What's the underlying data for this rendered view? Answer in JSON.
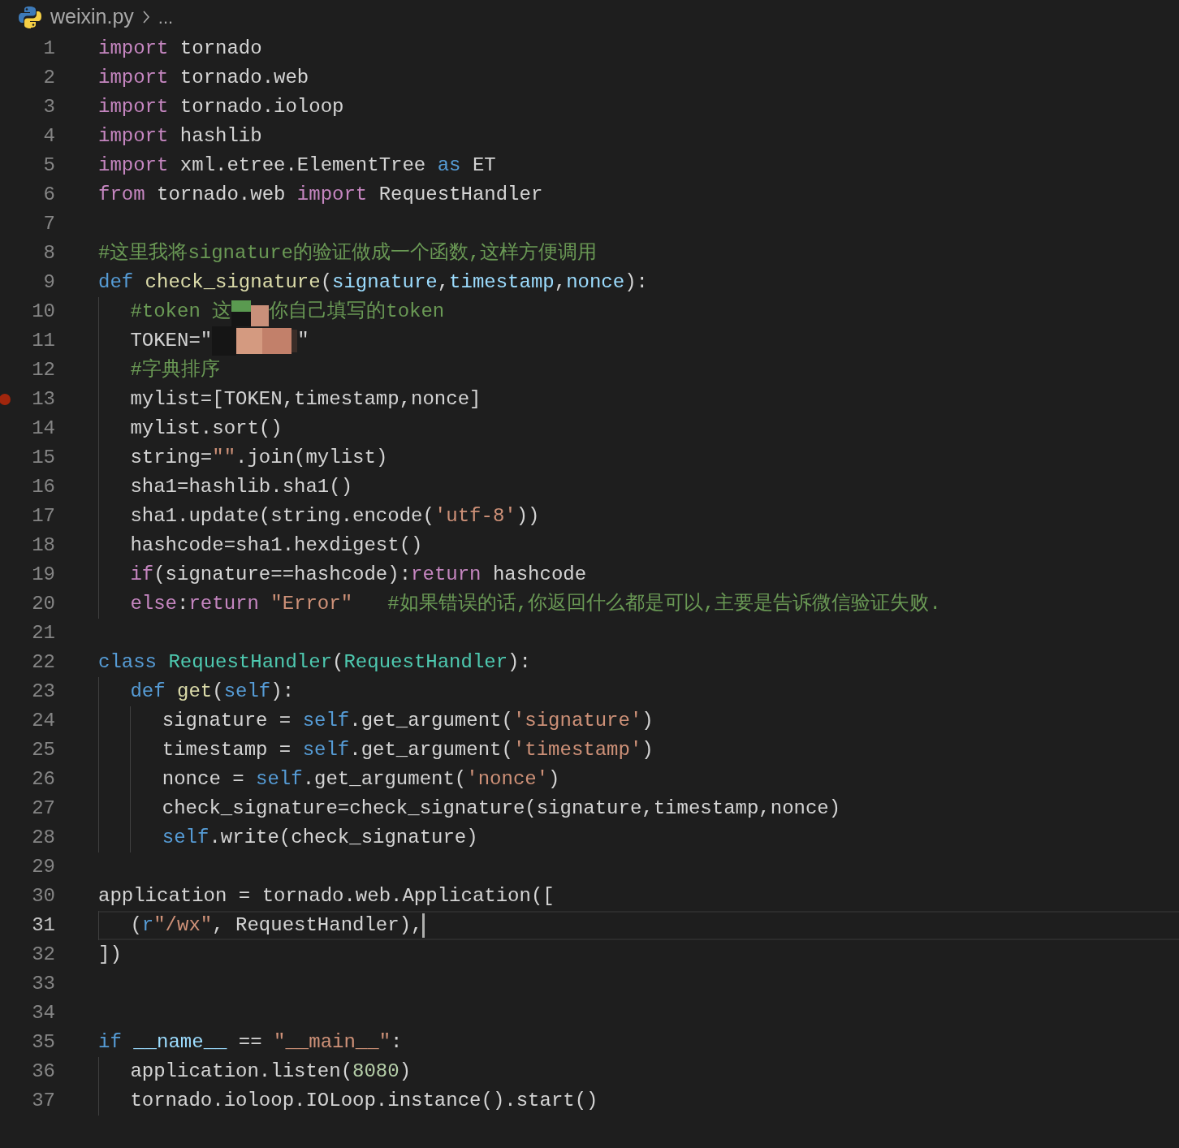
{
  "breadcrumb": {
    "file": "weixin.py",
    "more": "..."
  },
  "lines": [
    {
      "number": "1",
      "breakpoint": false,
      "current": false,
      "tokens": [
        {
          "kind": "kw",
          "text": "import"
        },
        {
          "kind": "tx",
          "text": " tornado"
        }
      ]
    },
    {
      "number": "2",
      "breakpoint": false,
      "current": false,
      "tokens": [
        {
          "kind": "kw",
          "text": "import"
        },
        {
          "kind": "tx",
          "text": " tornado.web"
        }
      ]
    },
    {
      "number": "3",
      "breakpoint": false,
      "current": false,
      "tokens": [
        {
          "kind": "kw",
          "text": "import"
        },
        {
          "kind": "tx",
          "text": " tornado.ioloop"
        }
      ]
    },
    {
      "number": "4",
      "breakpoint": false,
      "current": false,
      "tokens": [
        {
          "kind": "kw",
          "text": "import"
        },
        {
          "kind": "tx",
          "text": " hashlib"
        }
      ]
    },
    {
      "number": "5",
      "breakpoint": false,
      "current": false,
      "tokens": [
        {
          "kind": "kw",
          "text": "import"
        },
        {
          "kind": "tx",
          "text": " xml.etree.ElementTree "
        },
        {
          "kind": "st",
          "text": "as"
        },
        {
          "kind": "tx",
          "text": " ET"
        }
      ]
    },
    {
      "number": "6",
      "breakpoint": false,
      "current": false,
      "tokens": [
        {
          "kind": "kw",
          "text": "from"
        },
        {
          "kind": "tx",
          "text": " tornado.web "
        },
        {
          "kind": "kw",
          "text": "import"
        },
        {
          "kind": "tx",
          "text": " RequestHandler"
        }
      ]
    },
    {
      "number": "7",
      "breakpoint": false,
      "current": false
    },
    {
      "number": "8",
      "breakpoint": false,
      "current": false,
      "tokens": [
        {
          "kind": "cm",
          "text": "#这里我将signature的验证做成一个函数,这样方便调用"
        }
      ]
    },
    {
      "number": "9",
      "breakpoint": false,
      "current": false,
      "tokens": [
        {
          "kind": "st",
          "text": "def"
        },
        {
          "kind": "fn",
          "text": " check_signature"
        },
        {
          "kind": "tx",
          "text": "("
        },
        {
          "kind": "pa",
          "text": "signature"
        },
        {
          "kind": "tx",
          "text": ","
        },
        {
          "kind": "pa",
          "text": "timestamp"
        },
        {
          "kind": "tx",
          "text": ","
        },
        {
          "kind": "pa",
          "text": "nonce"
        },
        {
          "kind": "tx",
          "text": "):"
        }
      ]
    },
    {
      "number": "10",
      "breakpoint": false,
      "current": false,
      "tokens": [
        {
          "kind": "cm",
          "text": "    #token 这"
        },
        {
          "kind": "redaction"
        },
        {
          "kind": "cm",
          "text": "你自己填写的token"
        }
      ]
    },
    {
      "number": "11",
      "breakpoint": false,
      "current": false,
      "tokens": [
        {
          "kind": "tx",
          "text": "    TOKEN=\""
        },
        {
          "kind": "redaction"
        },
        {
          "kind": "tx",
          "text": "\""
        }
      ]
    },
    {
      "number": "12",
      "breakpoint": false,
      "current": false,
      "tokens": [
        {
          "kind": "cm",
          "text": "    #字典排序"
        }
      ]
    },
    {
      "number": "13",
      "breakpoint": true,
      "current": false,
      "tokens": [
        {
          "kind": "tx",
          "text": "    mylist=[TOKEN,timestamp,nonce]"
        }
      ]
    },
    {
      "number": "14",
      "breakpoint": false,
      "current": false,
      "tokens": [
        {
          "kind": "tx",
          "text": "    mylist.sort()"
        }
      ]
    },
    {
      "number": "15",
      "breakpoint": false,
      "current": false,
      "tokens": [
        {
          "kind": "tx",
          "text": "    string="
        },
        {
          "kind": "str",
          "text": "\"\""
        },
        {
          "kind": "tx",
          "text": ".join(mylist)"
        }
      ]
    },
    {
      "number": "16",
      "breakpoint": false,
      "current": false,
      "tokens": [
        {
          "kind": "tx",
          "text": "    sha1=hashlib.sha1()"
        }
      ]
    },
    {
      "number": "17",
      "breakpoint": false,
      "current": false,
      "tokens": [
        {
          "kind": "tx",
          "text": "    sha1.update(string.encode("
        },
        {
          "kind": "str",
          "text": "'utf-8'"
        },
        {
          "kind": "tx",
          "text": "))"
        }
      ]
    },
    {
      "number": "18",
      "breakpoint": false,
      "current": false,
      "tokens": [
        {
          "kind": "tx",
          "text": "    hashcode=sha1.hexdigest()"
        }
      ]
    },
    {
      "number": "19",
      "breakpoint": false,
      "current": false,
      "tokens": [
        {
          "kind": "kw",
          "text": "    if"
        },
        {
          "kind": "tx",
          "text": "(signature==hashcode):"
        },
        {
          "kind": "kw",
          "text": "return"
        },
        {
          "kind": "tx",
          "text": " hashcode"
        }
      ]
    },
    {
      "number": "20",
      "breakpoint": false,
      "current": false,
      "tokens": [
        {
          "kind": "kw",
          "text": "    else"
        },
        {
          "kind": "tx",
          "text": ":"
        },
        {
          "kind": "kw",
          "text": "return"
        },
        {
          "kind": "str",
          "text": " \"Error\""
        },
        {
          "kind": "cm",
          "text": "   #如果错误的话,你返回什么都是可以,主要是告诉微信验证失败."
        }
      ]
    },
    {
      "number": "21",
      "breakpoint": false,
      "current": false
    },
    {
      "number": "22",
      "breakpoint": false,
      "current": false,
      "tokens": [
        {
          "kind": "st",
          "text": "class"
        },
        {
          "kind": "cls",
          "text": " RequestHandler"
        },
        {
          "kind": "tx",
          "text": "("
        },
        {
          "kind": "cls",
          "text": "RequestHandler"
        },
        {
          "kind": "tx",
          "text": "):"
        }
      ]
    },
    {
      "number": "23",
      "breakpoint": false,
      "current": false,
      "tokens": [
        {
          "kind": "st",
          "text": "    def"
        },
        {
          "kind": "fn",
          "text": " get"
        },
        {
          "kind": "tx",
          "text": "("
        },
        {
          "kind": "st",
          "text": "self"
        },
        {
          "kind": "tx",
          "text": "):"
        }
      ]
    },
    {
      "number": "24",
      "breakpoint": false,
      "current": false,
      "tokens": [
        {
          "kind": "tx",
          "text": "        signature = "
        },
        {
          "kind": "st",
          "text": "self"
        },
        {
          "kind": "tx",
          "text": ".get_argument("
        },
        {
          "kind": "str",
          "text": "'signature'"
        },
        {
          "kind": "tx",
          "text": ")"
        }
      ]
    },
    {
      "number": "25",
      "breakpoint": false,
      "current": false,
      "tokens": [
        {
          "kind": "tx",
          "text": "        timestamp = "
        },
        {
          "kind": "st",
          "text": "self"
        },
        {
          "kind": "tx",
          "text": ".get_argument("
        },
        {
          "kind": "str",
          "text": "'timestamp'"
        },
        {
          "kind": "tx",
          "text": ")"
        }
      ]
    },
    {
      "number": "26",
      "breakpoint": false,
      "current": false,
      "tokens": [
        {
          "kind": "tx",
          "text": "        nonce = "
        },
        {
          "kind": "st",
          "text": "self"
        },
        {
          "kind": "tx",
          "text": ".get_argument("
        },
        {
          "kind": "str",
          "text": "'nonce'"
        },
        {
          "kind": "tx",
          "text": ")"
        }
      ]
    },
    {
      "number": "27",
      "breakpoint": false,
      "current": false,
      "tokens": [
        {
          "kind": "tx",
          "text": "        check_signature=check_signature(signature,timestamp,nonce)"
        }
      ]
    },
    {
      "number": "28",
      "breakpoint": false,
      "current": false,
      "tokens": [
        {
          "kind": "st",
          "text": "        self"
        },
        {
          "kind": "tx",
          "text": ".write(check_signature)"
        }
      ]
    },
    {
      "number": "29",
      "breakpoint": false,
      "current": false
    },
    {
      "number": "30",
      "breakpoint": false,
      "current": false,
      "tokens": [
        {
          "kind": "tx",
          "text": "application = tornado.web.Application(["
        }
      ]
    },
    {
      "number": "31",
      "breakpoint": false,
      "current": true,
      "tokens": [
        {
          "kind": "tx",
          "text": "    ("
        },
        {
          "kind": "st",
          "text": "r"
        },
        {
          "kind": "str",
          "text": "\"/wx\""
        },
        {
          "kind": "tx",
          "text": ", RequestHandler),"
        }
      ]
    },
    {
      "number": "32",
      "breakpoint": false,
      "current": false,
      "tokens": [
        {
          "kind": "tx",
          "text": "])"
        }
      ]
    },
    {
      "number": "33",
      "breakpoint": false,
      "current": false
    },
    {
      "number": "34",
      "breakpoint": false,
      "current": false
    },
    {
      "number": "35",
      "breakpoint": false,
      "current": false,
      "tokens": [
        {
          "kind": "st",
          "text": "if"
        },
        {
          "kind": "pa",
          "text": " __name__"
        },
        {
          "kind": "tx",
          "text": " == "
        },
        {
          "kind": "str",
          "text": "\"__main__\""
        },
        {
          "kind": "tx",
          "text": ":"
        }
      ]
    },
    {
      "number": "36",
      "breakpoint": false,
      "current": false,
      "tokens": [
        {
          "kind": "tx",
          "text": "    application.listen("
        },
        {
          "kind": "num",
          "text": "8080"
        },
        {
          "kind": "tx",
          "text": ")"
        }
      ]
    },
    {
      "number": "37",
      "breakpoint": false,
      "current": false,
      "tokens": [
        {
          "kind": "tx",
          "text": "    tornado.ioloop.IOLoop.instance().start()"
        }
      ]
    }
  ]
}
